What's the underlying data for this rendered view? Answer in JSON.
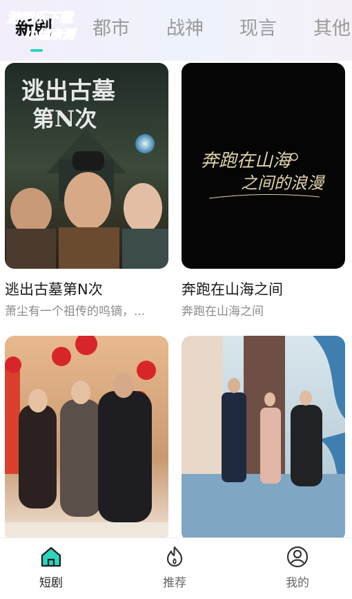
{
  "tabs": [
    {
      "label": "新剧",
      "active": true
    },
    {
      "label": "都市",
      "active": false
    },
    {
      "label": "战神",
      "active": false
    },
    {
      "label": "现言",
      "active": false
    },
    {
      "label": "其他",
      "active": false
    }
  ],
  "watermark": {
    "line1": "游吧乐下载",
    "line2": "小编亲测"
  },
  "cards": [
    {
      "title": "逃出古墓第N次",
      "desc": "萧尘有一个祖传的呜镝，...",
      "poster_text_line1": "逃出古墓",
      "poster_text_line2": "第N次"
    },
    {
      "title": "奔跑在山海之间",
      "desc": "奔跑在山海之间",
      "poster_text_line1": "奔跑在山海",
      "poster_text_line2": "之间的浪漫"
    },
    {
      "title": "",
      "desc": ""
    },
    {
      "title": "",
      "desc": ""
    }
  ],
  "bottom_nav": [
    {
      "label": "短剧",
      "icon": "home-icon",
      "active": true
    },
    {
      "label": "推荐",
      "icon": "flame-icon",
      "active": false
    },
    {
      "label": "我的",
      "icon": "user-icon",
      "active": false
    }
  ],
  "colors": {
    "accent": "#2dd4bf",
    "watermark": "#19b8e6"
  }
}
